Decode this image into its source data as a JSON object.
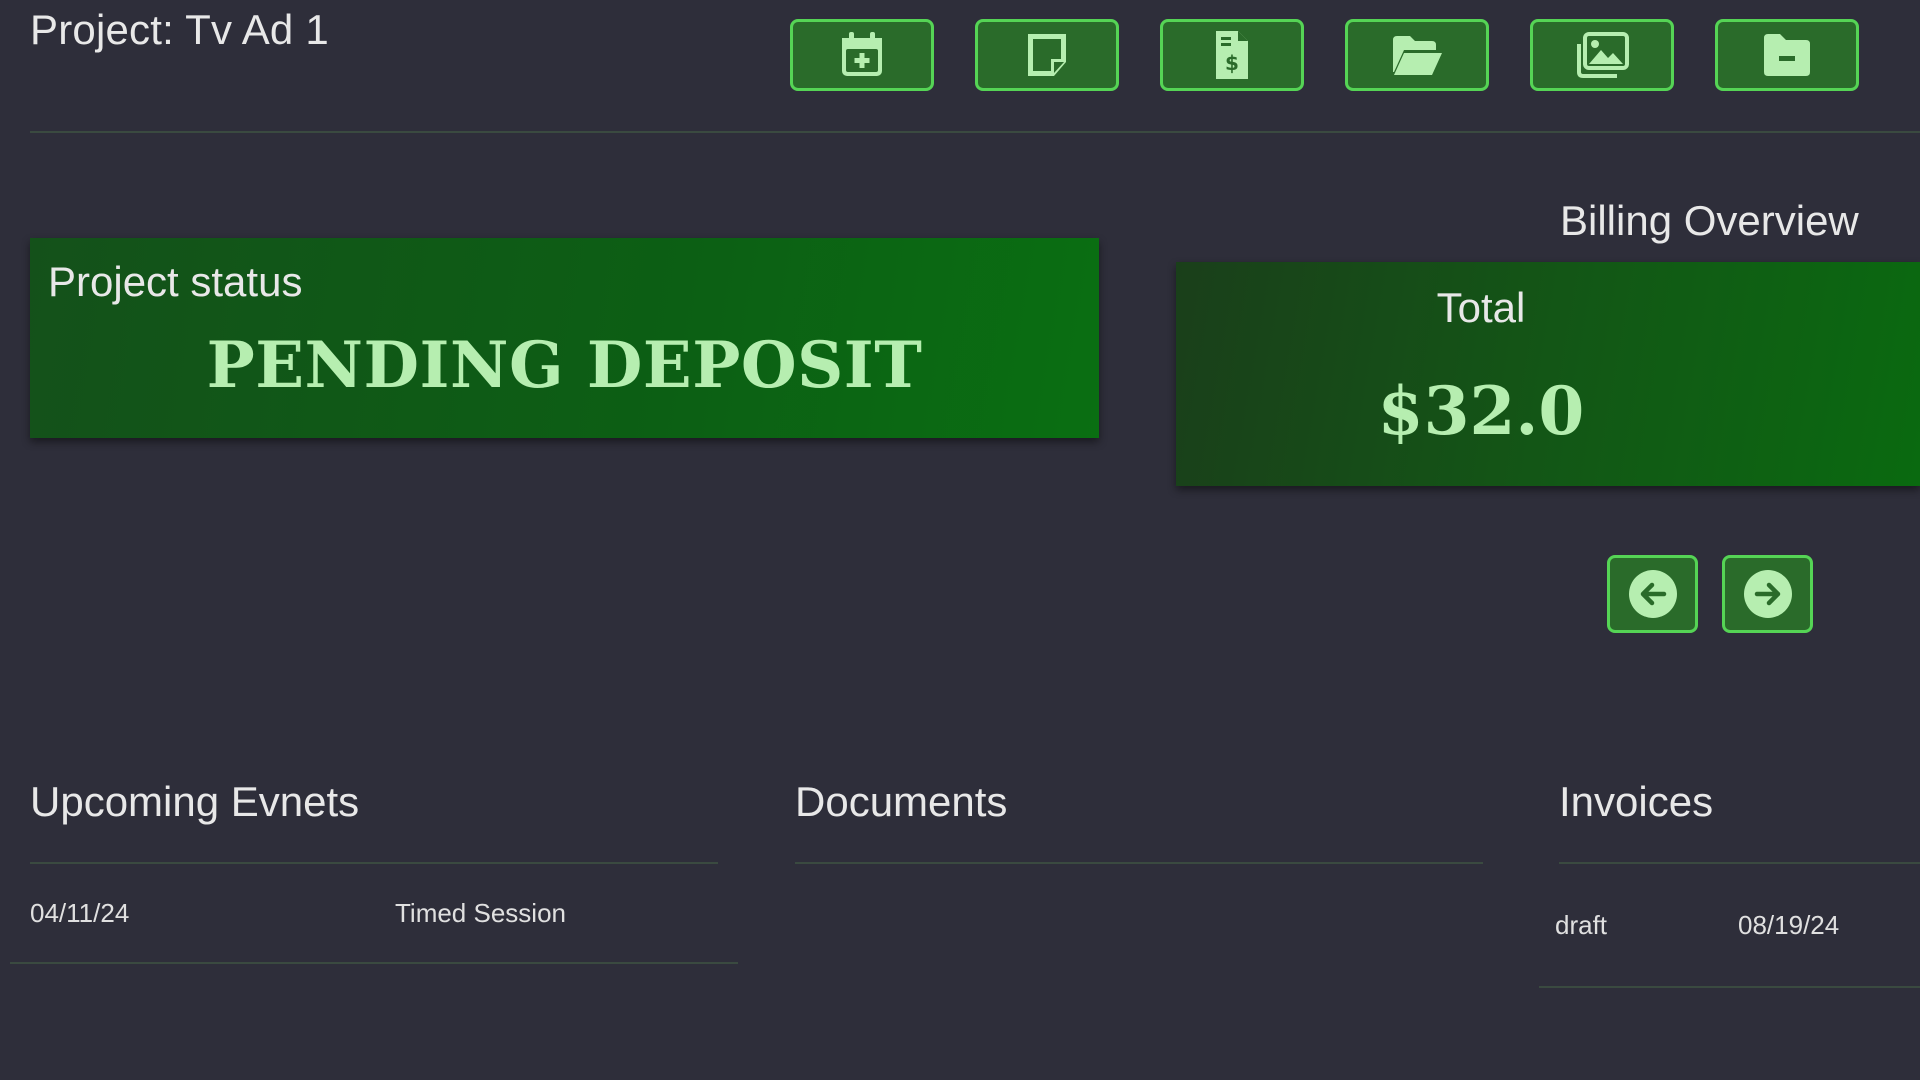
{
  "header": {
    "title": "Project: Tv Ad 1",
    "toolbar": [
      {
        "icon": "calendar-plus-icon"
      },
      {
        "icon": "sticky-note-icon"
      },
      {
        "icon": "invoice-dollar-icon"
      },
      {
        "icon": "folder-open-icon"
      },
      {
        "icon": "images-icon"
      },
      {
        "icon": "folder-minus-icon"
      }
    ]
  },
  "status": {
    "label": "Project status",
    "value": "PENDING DEPOSIT"
  },
  "billing": {
    "title": "Billing Overview",
    "total_label": "Total",
    "total_value": "$32.0",
    "nav": {
      "prev_icon": "arrow-left-circle-icon",
      "next_icon": "arrow-right-circle-icon"
    }
  },
  "events": {
    "title": "Upcoming Evnets",
    "rows": [
      {
        "date": "04/11/24",
        "name": "Timed Session"
      }
    ]
  },
  "documents": {
    "title": "Documents"
  },
  "invoices": {
    "title": "Invoices",
    "rows": [
      {
        "status": "draft",
        "date": "08/19/24"
      }
    ]
  },
  "colors": {
    "background": "#2e2e3a",
    "button_fill": "#2a6b2a",
    "button_border": "#55d455",
    "accent_text": "#b6eeb0",
    "card_green": "#0c5f14"
  }
}
